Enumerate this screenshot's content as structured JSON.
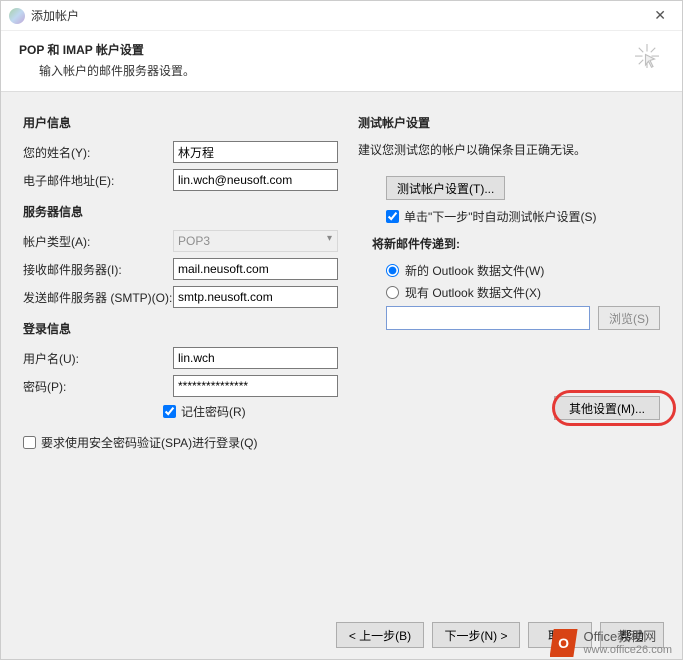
{
  "window": {
    "title": "添加帐户",
    "close": "✕"
  },
  "header": {
    "title": "POP 和 IMAP 帐户设置",
    "subtitle": "输入帐户的邮件服务器设置。"
  },
  "userinfo": {
    "section": "用户信息",
    "name_label": "您的姓名(Y):",
    "name_value": "林万程",
    "email_label": "电子邮件地址(E):",
    "email_value": "lin.wch@neusoft.com"
  },
  "serverinfo": {
    "section": "服务器信息",
    "type_label": "帐户类型(A):",
    "type_value": "POP3",
    "incoming_label": "接收邮件服务器(I):",
    "incoming_value": "mail.neusoft.com",
    "outgoing_label": "发送邮件服务器 (SMTP)(O):",
    "outgoing_value": "smtp.neusoft.com"
  },
  "login": {
    "section": "登录信息",
    "user_label": "用户名(U):",
    "user_value": "lin.wch",
    "pass_label": "密码(P):",
    "pass_value": "***************",
    "remember": "记住密码(R)",
    "spa": "要求使用安全密码验证(SPA)进行登录(Q)"
  },
  "test": {
    "section": "测试帐户设置",
    "desc": "建议您测试您的帐户以确保条目正确无误。",
    "button": "测试帐户设置(T)...",
    "autotest": "单击\"下一步\"时自动测试帐户设置(S)"
  },
  "deliver": {
    "section": "将新邮件传递到:",
    "new": "新的 Outlook 数据文件(W)",
    "existing": "现有 Outlook 数据文件(X)",
    "browse": "浏览(S)"
  },
  "other": "其他设置(M)...",
  "footer": {
    "back": "< 上一步(B)",
    "next": "下一步(N) >",
    "cancel": "取消",
    "help": "帮助"
  },
  "watermark": {
    "brand": "Office教程网",
    "url": "www.office26.com"
  }
}
